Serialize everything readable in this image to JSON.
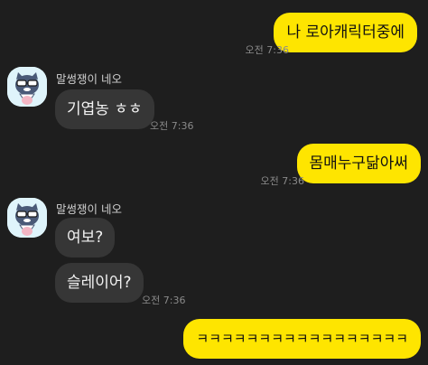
{
  "chat": {
    "sender_name": "말썽쟁이 네오",
    "messages": [
      {
        "text": "나 로아캐릭터중에",
        "time": "오전 7:36"
      },
      {
        "text": "기엽농 ㅎㅎ",
        "time": "오전 7:36"
      },
      {
        "text": "몸매누구닮아써",
        "time": "오전 7:36"
      },
      {
        "text": "여보?"
      },
      {
        "text": "슬레이어?",
        "time": "오전 7:36"
      },
      {
        "text": "ㅋㅋㅋㅋㅋㅋㅋㅋㅋㅋㅋㅋㅋㅋㅋㅋㅋ"
      }
    ]
  },
  "colors": {
    "background": "#1e1e1e",
    "outgoing_bubble": "#fee500",
    "incoming_bubble": "#363636",
    "timestamp": "#8a8a8a"
  },
  "avatar_icon": "neo-cat-character-icon"
}
